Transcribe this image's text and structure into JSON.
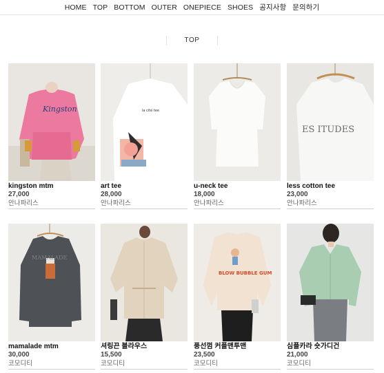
{
  "nav": {
    "items": [
      {
        "label": "HOME"
      },
      {
        "label": "TOP"
      },
      {
        "label": "BOTTOM"
      },
      {
        "label": "OUTER"
      },
      {
        "label": "ONEPIECE"
      },
      {
        "label": "SHOES"
      },
      {
        "label": "공지사항"
      },
      {
        "label": "문의하기"
      }
    ]
  },
  "category": {
    "title": "TOP"
  },
  "products": [
    {
      "name": "kingston mtm",
      "price": "27,000",
      "brand": "안나파리스",
      "print": "Kingston"
    },
    {
      "name": "art tee",
      "price": "28,000",
      "brand": "안나파리스",
      "print": "la cité tee"
    },
    {
      "name": "u-neck tee",
      "price": "18,000",
      "brand": "안나파리스",
      "print": ""
    },
    {
      "name": "less cotton tee",
      "price": "23,000",
      "brand": "안나파리스",
      "print": "ES ITUDES"
    },
    {
      "name": "mamalade mtm",
      "price": "30,000",
      "brand": "코모디티",
      "print": "MAMALADE"
    },
    {
      "name": "셔링끈 블라우스",
      "price": "15,500",
      "brand": "코모디티",
      "print": ""
    },
    {
      "name": "풍선껌 커플맨투맨",
      "price": "23,500",
      "brand": "코모디티",
      "print": "BLOW BUBBLE GUM"
    },
    {
      "name": "심플카라 숏가디건",
      "price": "21,000",
      "brand": "코모디티",
      "print": ""
    }
  ]
}
